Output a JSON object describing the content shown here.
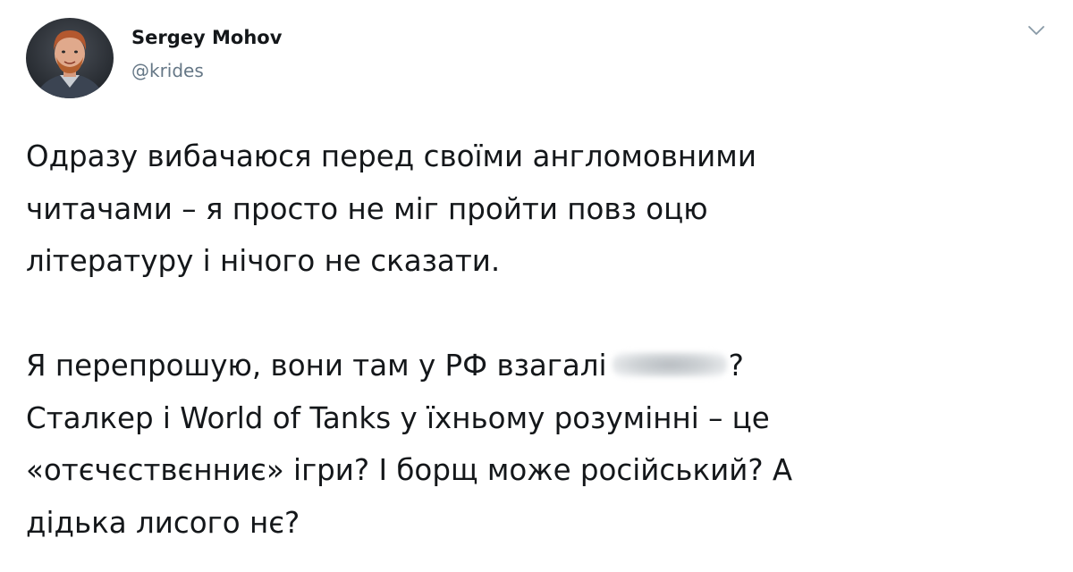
{
  "author": {
    "name": "Sergey Mohov",
    "handle": "@krides",
    "avatar_icon": "profile-photo",
    "menu_icon": "chevron-down-icon"
  },
  "tweet": {
    "paragraph1": [
      "Одразу вибачаюся перед своїми англомовними",
      "читачами – я просто не міг пройти повз оцю",
      "літературу і нічого не сказати."
    ],
    "paragraph2": {
      "line1_before": "Я перепрошую, вони там у РФ взагалі",
      "line1_after": "?",
      "lines": [
        "Сталкер і World of Tanks у їхньому розумінні – це",
        "«отєчєствєнниє» ігри? І борщ може російський? А",
        "дідька лисого нє?"
      ]
    }
  },
  "colors": {
    "text": "#14171a",
    "secondary": "#657786",
    "background": "#ffffff"
  }
}
